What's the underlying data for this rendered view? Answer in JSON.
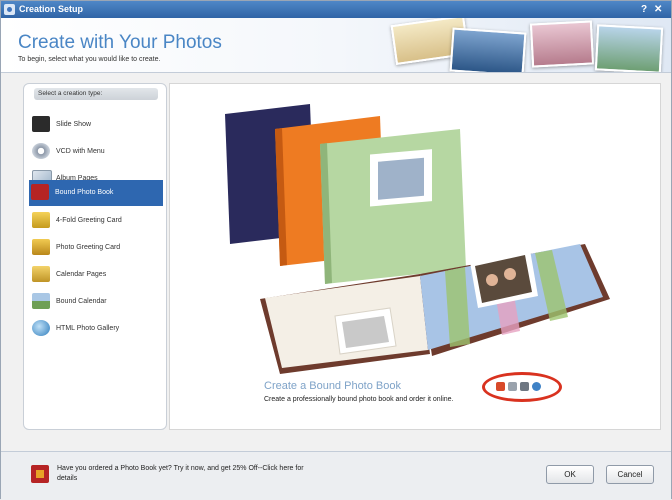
{
  "window": {
    "title": "Creation Setup",
    "controls": "? X"
  },
  "header": {
    "title": "Create with Your Photos",
    "subtitle": "To begin, select what you would like to create."
  },
  "sidebar": {
    "heading": "Select a creation type:",
    "items": [
      {
        "label": "Slide Show",
        "icon": "slideshow-icon"
      },
      {
        "label": "VCD with Menu",
        "icon": "vcd-disc-icon"
      },
      {
        "label": "Album Pages",
        "icon": "album-pages-icon"
      },
      {
        "label": "Bound Photo Book",
        "icon": "photo-book-icon",
        "selected": true
      },
      {
        "label": "4-Fold Greeting Card",
        "icon": "greeting-card-icon"
      },
      {
        "label": "Photo Greeting Card",
        "icon": "photo-card-icon"
      },
      {
        "label": "Calendar Pages",
        "icon": "calendar-pages-icon"
      },
      {
        "label": "Bound Calendar",
        "icon": "bound-calendar-icon"
      },
      {
        "label": "HTML Photo Gallery",
        "icon": "web-gallery-icon"
      }
    ]
  },
  "preview": {
    "title": "Create a Bound Photo Book",
    "description": "Create a professionally bound photo book and order it online."
  },
  "footer": {
    "promo": "Have you ordered a Photo Book yet? Try it now, and get 25% Off--Click here for details",
    "ok_label": "OK",
    "cancel_label": "Cancel"
  },
  "colors": {
    "accent": "#2e67b0",
    "title_blue": "#4a86c5",
    "highlight_circle": "#d9321f"
  }
}
